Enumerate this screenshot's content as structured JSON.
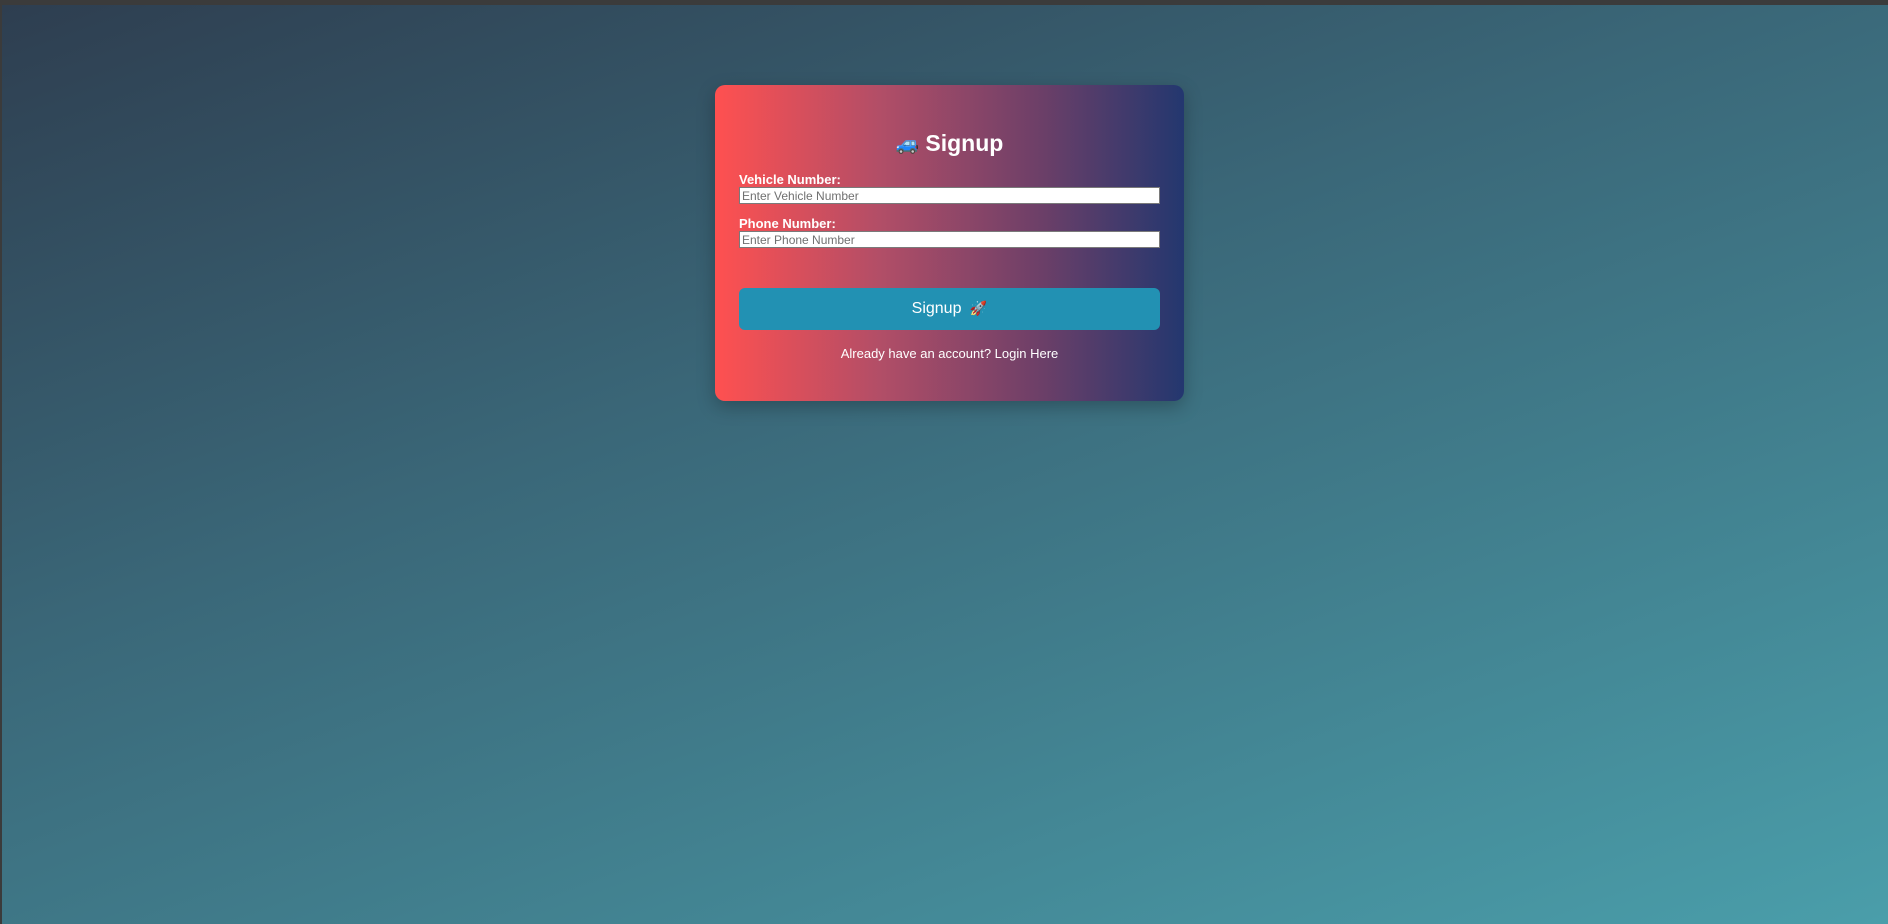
{
  "signup": {
    "title": "Signup",
    "title_icon": "car-icon",
    "title_icon_glyph": "🚙",
    "vehicle": {
      "label": "Vehicle Number:",
      "placeholder": "Enter Vehicle Number",
      "value": ""
    },
    "phone": {
      "label": "Phone Number:",
      "placeholder": "Enter Phone Number",
      "value": ""
    },
    "button_label": "Signup",
    "button_icon": "rocket-icon",
    "button_icon_glyph": "🚀",
    "footer_text": "Already have an account?",
    "login_link": "Login Here"
  },
  "colors": {
    "card_gradient_start": "#ff5050",
    "card_gradient_end": "#23376f",
    "button_bg": "#2291b3",
    "page_gradient_start": "#2e3e50",
    "page_gradient_end": "#4a9eaa"
  }
}
